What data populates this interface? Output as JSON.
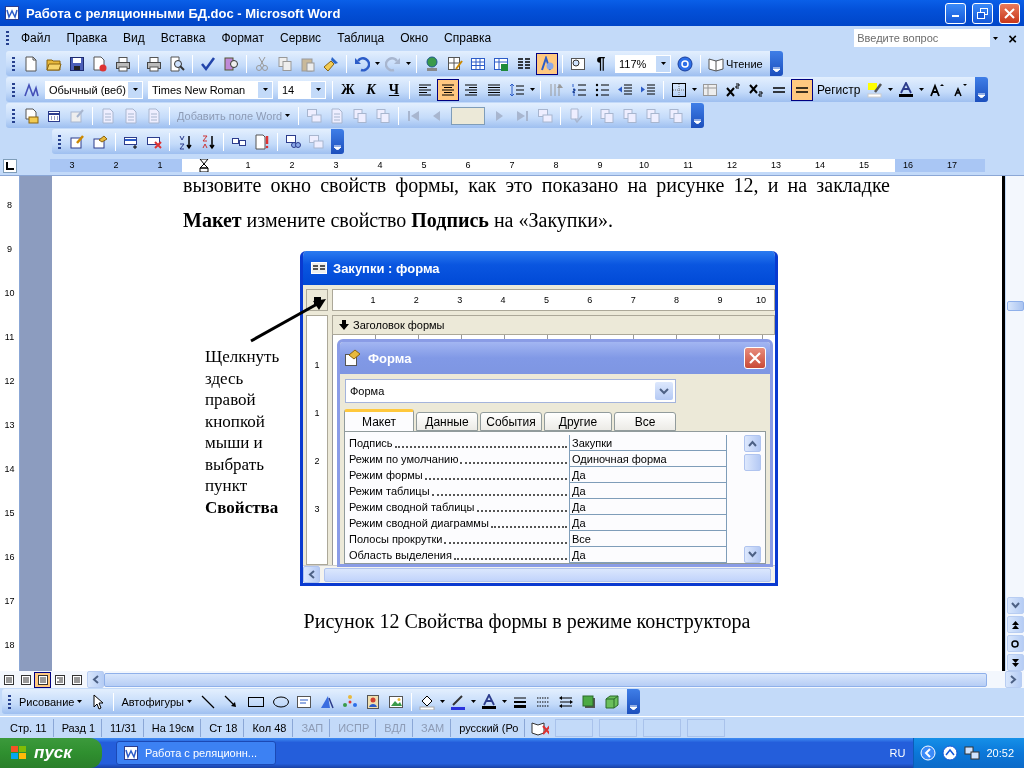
{
  "window": {
    "title": "Работа с реляционными БД.doc - Microsoft Word"
  },
  "menu": [
    {
      "label": "Файл"
    },
    {
      "label": "Правка"
    },
    {
      "label": "Вид"
    },
    {
      "label": "Вставка"
    },
    {
      "label": "Формат"
    },
    {
      "label": "Сервис"
    },
    {
      "label": "Таблица"
    },
    {
      "label": "Окно"
    },
    {
      "label": "Справка"
    }
  ],
  "help_search": {
    "placeholder": "Введите вопрос",
    "close": "×"
  },
  "standard_toolbar": {
    "drawing_selected": true,
    "pilcrow": "¶",
    "zoom": "117%",
    "reading": "Чтение"
  },
  "formatting_toolbar": {
    "style": "Обычный (веб)",
    "font": "Times New Roman",
    "size": "14",
    "bold": "Ж",
    "italic": "К",
    "underline": "Ч",
    "alignments": [
      {
        "selected": false
      },
      {
        "selected": true
      },
      {
        "selected": false
      },
      {
        "selected": false
      }
    ],
    "line_selected": true,
    "case": "Регистр"
  },
  "mail_merge_toolbar": {
    "insert_field": "Добавить поле Word"
  },
  "ruler": {
    "left_labels": [
      "3",
      "2",
      "1"
    ],
    "labels": [
      "1",
      "2",
      "3",
      "4",
      "5",
      "6",
      "7",
      "8",
      "9",
      "10",
      "11",
      "12",
      "13",
      "14",
      "15",
      "16",
      "17"
    ]
  },
  "vertical_ruler": {
    "labels": [
      "8",
      "9",
      "10",
      "11",
      "12",
      "13",
      "14",
      "15",
      "16",
      "17",
      "18"
    ]
  },
  "document": {
    "paragraph": "вызовите окно свойств формы, как это показано на рисунке 12, и на закладке **Макет** измените свойство **Подпись** на «Закупки».",
    "callout": "Щелкнуть здесь правой кнопкой мыши и выбрать пункт **Свойства**",
    "caption": "Рисунок 12 Свойства формы в режиме конструктора"
  },
  "figure": {
    "title": "Закупки : форма",
    "ruler": [
      "1",
      "2",
      "3",
      "4",
      "5",
      "6",
      "7",
      "8",
      "9",
      "10"
    ],
    "section": "Заголовок формы",
    "vruler": [
      "1",
      "1",
      "2",
      "3"
    ],
    "dialog": {
      "title": "Форма",
      "object": "Форма",
      "tabs": [
        {
          "label": "Макет",
          "selected": true
        },
        {
          "label": "Данные",
          "selected": false
        },
        {
          "label": "События",
          "selected": false
        },
        {
          "label": "Другие",
          "selected": false
        },
        {
          "label": "Все",
          "selected": false
        }
      ],
      "properties": [
        {
          "name": "Подпись",
          "value": "Закупки"
        },
        {
          "name": "Режим по умолчанию",
          "value": "Одиночная форма"
        },
        {
          "name": "Режим формы",
          "value": "Да"
        },
        {
          "name": "Режим таблицы",
          "value": "Да"
        },
        {
          "name": "Режим сводной таблицы",
          "value": "Да"
        },
        {
          "name": "Режим сводной диаграммы",
          "value": "Да"
        },
        {
          "name": "Полосы прокрутки",
          "value": "Все"
        },
        {
          "name": "Область выделения",
          "value": "Да"
        }
      ]
    }
  },
  "views": [
    {
      "selected": false
    },
    {
      "selected": false
    },
    {
      "selected": true
    },
    {
      "selected": false
    },
    {
      "selected": false
    }
  ],
  "drawing_toolbar": {
    "drawing": "Рисование",
    "autoshapes": "Автофигуры"
  },
  "status_bar": [
    {
      "text": "Стр. 11",
      "disabled": false
    },
    {
      "text": "Разд 1",
      "disabled": false
    },
    {
      "text": "11/31",
      "disabled": false
    },
    {
      "text": "На 19см",
      "disabled": false
    },
    {
      "text": "Ст 18",
      "disabled": false
    },
    {
      "text": "Кол 48",
      "disabled": false
    },
    {
      "text": "ЗАП",
      "disabled": true
    },
    {
      "text": "ИСПР",
      "disabled": true
    },
    {
      "text": "ВДЛ",
      "disabled": true
    },
    {
      "text": "ЗАМ",
      "disabled": true
    },
    {
      "text": "русский (Ро",
      "disabled": false
    }
  ],
  "taskbar": {
    "start": "пуск",
    "tasks": [
      {
        "label": "Работа с реляционн...",
        "selected": false
      }
    ],
    "language": "RU",
    "clock": "20:52"
  }
}
